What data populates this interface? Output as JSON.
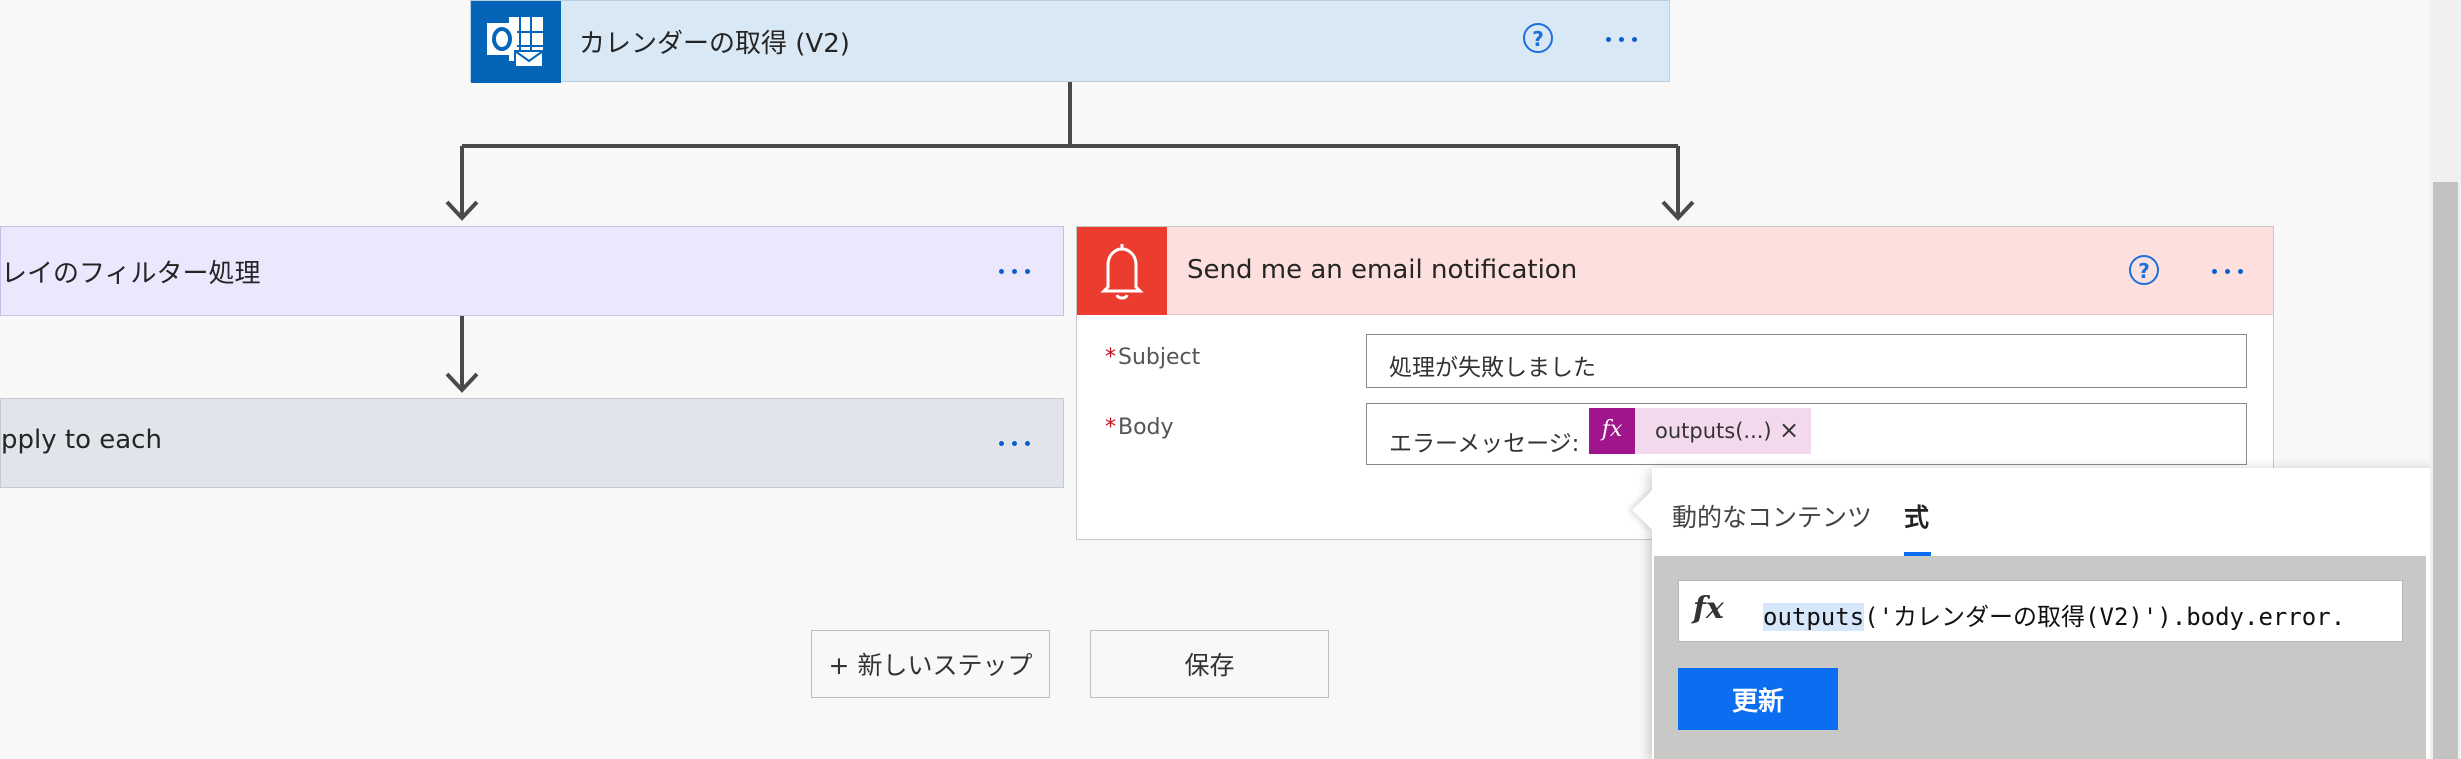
{
  "calendar_step": {
    "title": "カレンダーの取得 (V2)",
    "help_icon": "question-circle-icon",
    "icon": "outlook-calendar-icon",
    "accent": "#0364b8",
    "background": "#d8e8f5"
  },
  "filter_step": {
    "title": "レイのフィルター処理",
    "background": "#ebe7fd"
  },
  "apply_step": {
    "title": "pply to each",
    "background": "#e1e4ea"
  },
  "email_step": {
    "title": "Send me an email notification",
    "icon": "bell-icon",
    "accent": "#eb3c2f",
    "background": "#fde0dd",
    "fields": {
      "subject_label": "Subject",
      "subject_value": "処理が失敗しました",
      "body_label": "Body",
      "body_prefix": "エラーメッセージ:",
      "token_label": "outputs(...)",
      "token_icon": "fx-icon",
      "token_remove": "×"
    }
  },
  "buttons": {
    "new_step": "+ 新しいステップ",
    "save": "保存"
  },
  "expression_panel": {
    "tabs": [
      "動的なコンテンツ",
      "式"
    ],
    "active_tab": "式",
    "fx_symbol": "fx",
    "expression_func": "outputs",
    "expression_rest": "('カレンダーの取得(V2)').body.error.",
    "update_button": "更新",
    "accent": "#0b6ef0"
  }
}
